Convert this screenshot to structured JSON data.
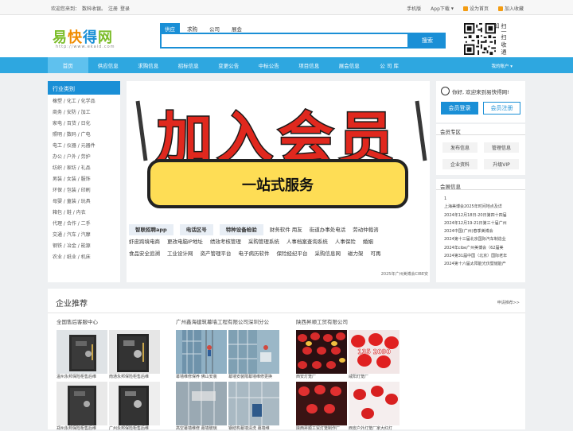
{
  "topbar": {
    "welcome": "欢迎您来到：",
    "site": "数科收银。",
    "register": "注册",
    "login": "登录",
    "mobile": "手机版",
    "app": "App下载",
    "homepage": "设为首页",
    "favorite": "加入收藏"
  },
  "logo": {
    "c1": "易",
    "c2": "快",
    "c3": "得",
    "c4": "网",
    "url": "http://www.ekaid.com"
  },
  "search": {
    "tabs": [
      "供应",
      "求购",
      "公司",
      "展会"
    ],
    "button": "搜索",
    "qr_text": "扫一扫 收 通 知"
  },
  "nav": {
    "items": [
      "首页",
      "供应信息",
      "求购信息",
      "招标信息",
      "变更公告",
      "中标公告",
      "项目信息",
      "展会信息",
      "公 司 库"
    ],
    "account": "我的账户 ▾"
  },
  "categories": {
    "title": "行业类别",
    "items": [
      "橡塑 / 化工 / 化学品",
      "商务 / 安防 / 加工",
      "家电 / 百货 / 日化",
      "照明 / 数码 / 广电",
      "电工 / 仪器 / 元器件",
      "办公 / 户外 / 劳护",
      "纺织 / 家纺 / 礼品",
      "男装 / 女装 / 服饰",
      "环保 / 包装 / 印刷",
      "母婴 / 童装 / 玩具",
      "箱包 / 鞋 / 内衣",
      "代理 / 合作 / 二手",
      "交通 / 汽车 / 汽摩",
      "钢铁 / 冶金 / 能源",
      "农业 / 纸业 / 机床"
    ]
  },
  "banner": {
    "title": "加入会员",
    "subtitle": "一站式服务"
  },
  "links": {
    "row1": [
      {
        "t": "智联招聘app",
        "hl": true
      },
      {
        "t": "电话区号",
        "hl": true
      },
      {
        "t": "特种设备检验",
        "hl": true
      },
      {
        "t": "财务软件 用友",
        "hl": false
      },
      {
        "t": "街道办事处电话",
        "hl": false
      },
      {
        "t": "劳动仲裁咨",
        "hl": false
      }
    ],
    "row2": [
      "虾皮跨境电商",
      "更改电脑IP地址",
      "绩效考核管理",
      "采购管理系统",
      "人事档案查询系统",
      "人事保险",
      "婚姻"
    ],
    "row3": [
      "食品安全追溯",
      "工业设计网",
      "资产管理平台",
      "电子病历软件",
      "保险经纪平台",
      "采购信息网",
      "磁力架",
      "可再"
    ],
    "footer": "2025年广州美博会CIBE安"
  },
  "user": {
    "greeting": "你好, 欢迎来到易快得网!",
    "login": "会员登录",
    "register": "会员注册"
  },
  "member_zone": {
    "title": "会员专区",
    "buttons": [
      "发布信息",
      "管理信息",
      "企业资料",
      "升级VIP"
    ]
  },
  "expo": {
    "title": "会展信息",
    "items": [
      "1",
      "上海美博会2025年时间地点及详",
      "2024年12月18日-20日第四十四届",
      "2024年12月19-21日第三十届广州",
      "2024中国(广州)春季美博会",
      "2024第十三届北京国际汽车制造业",
      "2024年cibe广州美博会（62届美",
      "2024第31届中国（北京）国际老年",
      "2024第十六届太阳能光伏暨储能产"
    ]
  },
  "enterprise": {
    "title": "企业推荐",
    "more": "申请推荐>>",
    "columns": [
      {
        "name": "全国售后客服中心",
        "captions": [
          "温州永邦保险柜售后维",
          "南通永邦保险柜售后维",
          "郑州永邦保险柜售后维",
          "广州永邦保险柜售后维"
        ]
      },
      {
        "name": "广州鑫海建筑幕墙工程有限公司深圳分公",
        "captions": [
          "幕墙维修保养 佛山安装",
          "幕墙安装隔幕墙维修更换",
          "高空幕墙维修 幕墙玻璃",
          "钢结构幕墙清洗 幕墙维"
        ]
      },
      {
        "name": "陕西昇顺工贸有限公司",
        "captions": [
          "西安灯笼厂",
          "咸阳灯笼厂",
          "陕西昇顺工贸灯笼制作厂",
          "西安户外灯笼厂家大红灯"
        ]
      }
    ]
  },
  "colors": {
    "primary": "#1a8fd6",
    "nav": "#2ea7e0",
    "banner_text": "#e0281e",
    "banner_box": "#fedd55"
  }
}
